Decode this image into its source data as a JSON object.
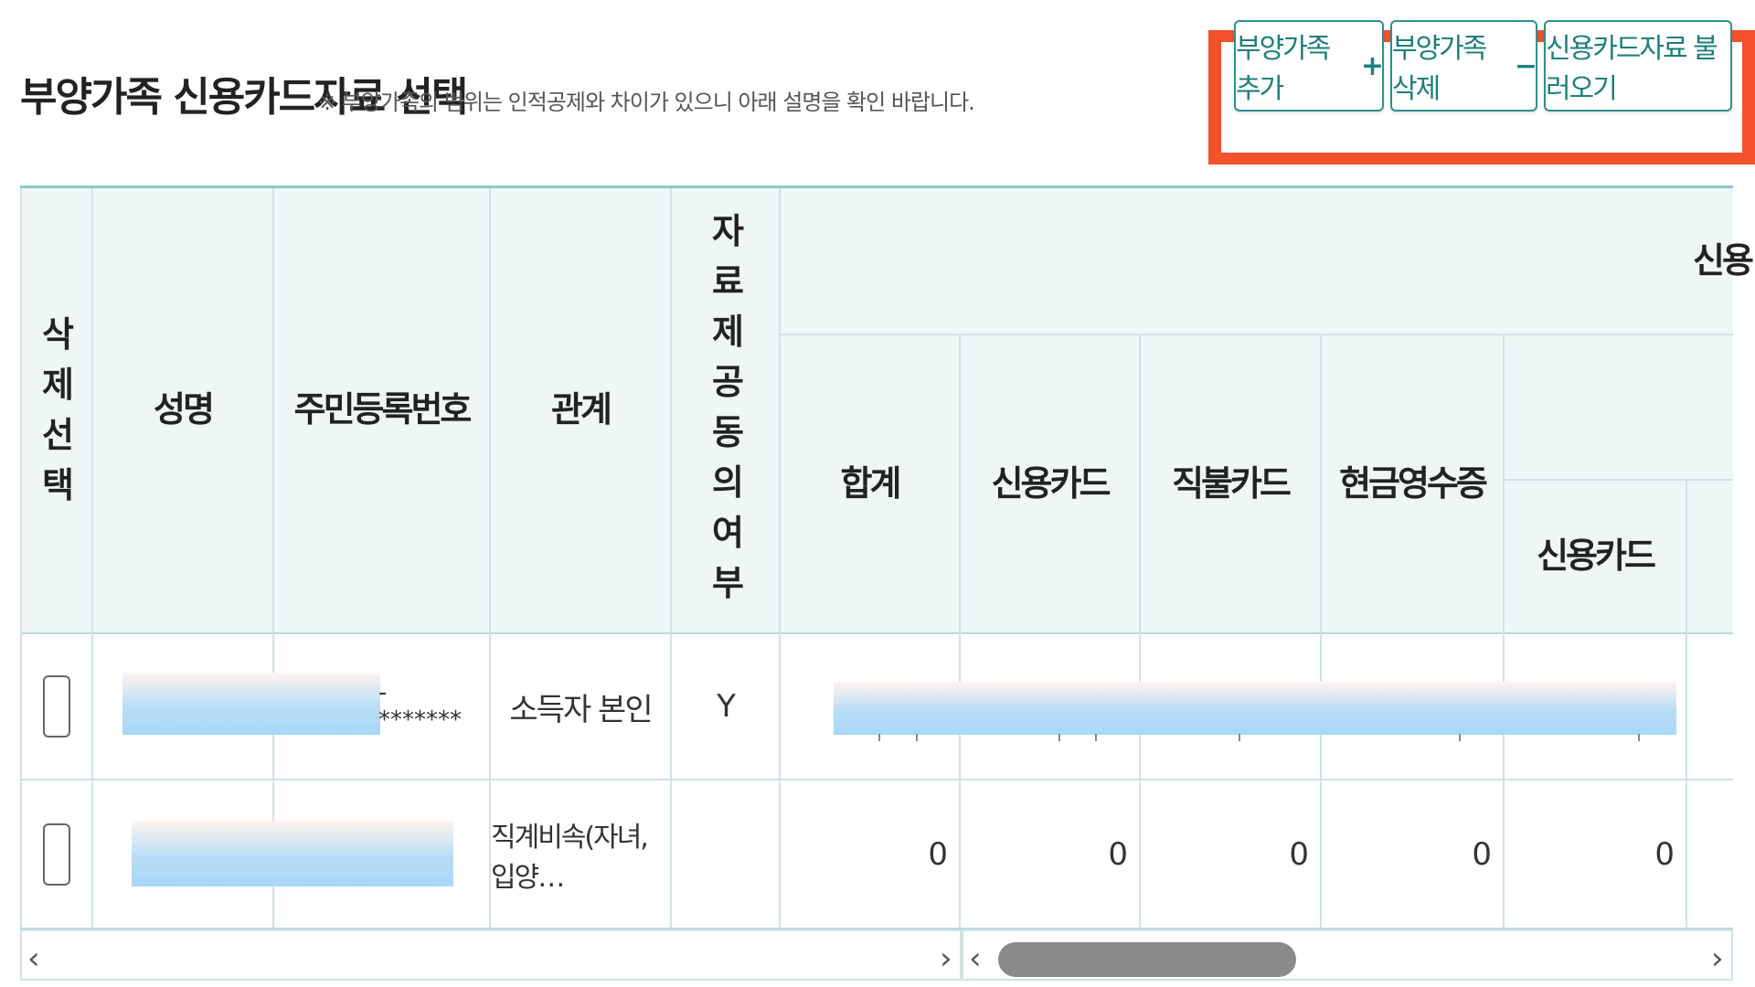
{
  "header": {
    "title": "부양가족 신용카드자료 선택",
    "note": "※ 부양가족의 범위는 인적공제와 차이가 있으니 아래 설명을 확인 바랍니다."
  },
  "buttons": {
    "add": {
      "label": "부양가족 추가",
      "symbol": "+"
    },
    "delete": {
      "label": "부양가족 삭제",
      "symbol": "−"
    },
    "load": {
      "label": "신용카드자료 불러오기"
    }
  },
  "table": {
    "headers": {
      "delete_select": "삭제 선택",
      "name": "성명",
      "rrn": "주민등록번호",
      "relation": "관계",
      "consent": "자료 제공 동의 여부",
      "group_partial": "신용",
      "total": "합계",
      "credit_card": "신용카드",
      "debit_card": "직불카드",
      "cash_receipt": "현금영수증",
      "sub_credit_card": "신용카드"
    },
    "rows": [
      {
        "rrn_suffix": "-*******",
        "relation": "소득자 본인",
        "consent": "Y"
      },
      {
        "relation": "직계비속(자녀,입양…",
        "total": "0",
        "credit": "0",
        "debit": "0",
        "cash": "0",
        "sub_credit": "0"
      }
    ]
  },
  "scrollbar": {
    "left_arrow": "‹",
    "right_arrow": "›"
  }
}
